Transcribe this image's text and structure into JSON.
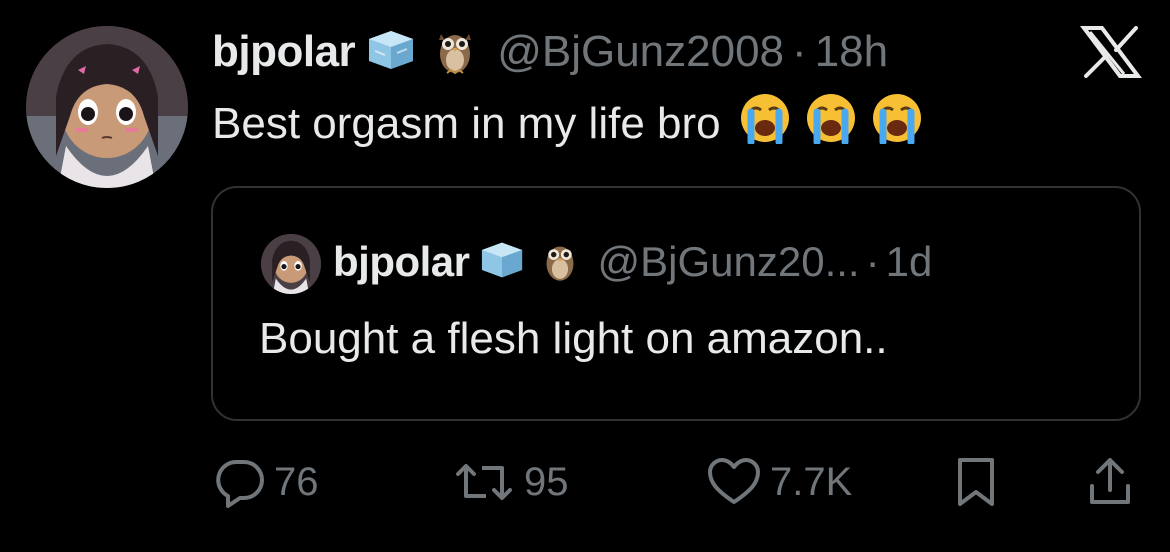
{
  "tweet": {
    "display_name": "bjpolar",
    "handle": "@BjGunz2008",
    "separator": "·",
    "time": "18h",
    "text": "Best orgasm in my life bro",
    "emojis": [
      "loudly-crying-face",
      "loudly-crying-face",
      "loudly-crying-face"
    ],
    "badge_icon": "ice-cube-icon",
    "extra_icon": "owl-icon"
  },
  "quoted_tweet": {
    "display_name": "bjpolar",
    "handle": "@BjGunz20...",
    "separator": "·",
    "time": "1d",
    "text": "Bought a flesh light on amazon.."
  },
  "actions": {
    "replies": "76",
    "reposts": "95",
    "likes": "7.7K"
  },
  "colors": {
    "background": "#000000",
    "text_primary": "#e7e9ea",
    "text_secondary": "#71767b",
    "border": "#2f3336"
  }
}
